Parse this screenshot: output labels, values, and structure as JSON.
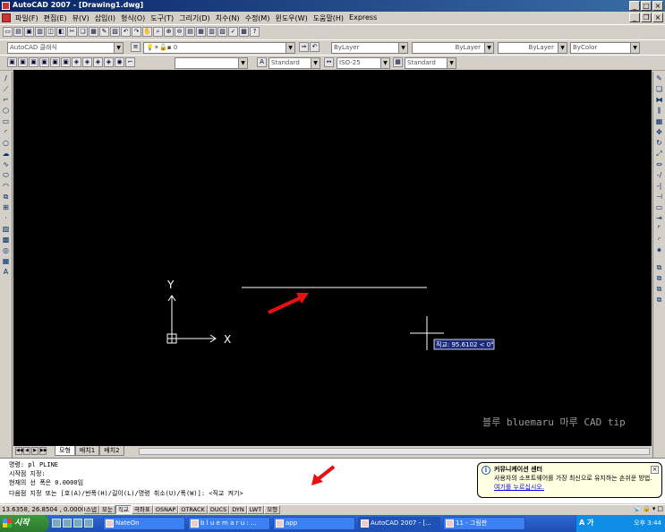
{
  "window": {
    "title": "AutoCAD 2007 - [Drawing1.dwg]"
  },
  "menus": [
    "파일(F)",
    "편집(E)",
    "뷰(V)",
    "삽입(I)",
    "형식(O)",
    "도구(T)",
    "그리기(D)",
    "치수(N)",
    "수정(M)",
    "윈도우(W)",
    "도움말(H)",
    "Express"
  ],
  "toolbar2": {
    "workspace": "AutoCAD 클래식",
    "layer": "0",
    "color": "ByLayer",
    "linetype": "ByLayer",
    "lineweight": "ByLayer",
    "plotstyle": "ByColor"
  },
  "toolbar3": {
    "text_style": "Standard",
    "dim_style": "ISO-25",
    "table_style": "Standard"
  },
  "canvas": {
    "ucs_x": "X",
    "ucs_y": "Y",
    "tooltip": "직교: 95.6102 < 0°",
    "watermark": "블루 bluemaru 마루 CAD tip",
    "colors": {
      "background": "#000000",
      "line": "#ffffff",
      "arrow": "#e81010",
      "tooltip_bg": "#1a2a7a"
    }
  },
  "tabs": [
    "모형",
    "배치1",
    "배치2"
  ],
  "command": {
    "lines": [
      "명령: pl PLINE",
      "시작점 지정:",
      "현재의 선 폭은 0.0000임",
      "다음점 지정 또는 [호(A)/반폭(H)/길이(L)/명령 취소(U)/폭(W)]:  <직교 켜기>"
    ]
  },
  "balloon": {
    "title": "커뮤니케이션 센터",
    "text": "사용자의 소프트웨어를 가장 최신으로 유지하는 손쉬운 방법.",
    "link": "여기를 누르십시오."
  },
  "status": {
    "coords": "13.6358, 26.8504 , 0.0000",
    "buttons": [
      {
        "label": "스냅",
        "on": false
      },
      {
        "label": "모눈",
        "on": false
      },
      {
        "label": "직교",
        "on": true
      },
      {
        "label": "극좌표",
        "on": false
      },
      {
        "label": "OSNAP",
        "on": false
      },
      {
        "label": "OTRACK",
        "on": false
      },
      {
        "label": "DUCS",
        "on": false
      },
      {
        "label": "DYN",
        "on": false
      },
      {
        "label": "LWT",
        "on": false
      },
      {
        "label": "모형",
        "on": false
      }
    ]
  },
  "taskbar": {
    "start": "시작",
    "tasks": [
      "NateOn",
      "b l u e m a r u : ...",
      "app",
      "AutoCAD 2007 - [...",
      "11 - 그림판"
    ],
    "active_task_index": 3,
    "tray_ime": "A 가",
    "clock": "오후 3:44"
  }
}
